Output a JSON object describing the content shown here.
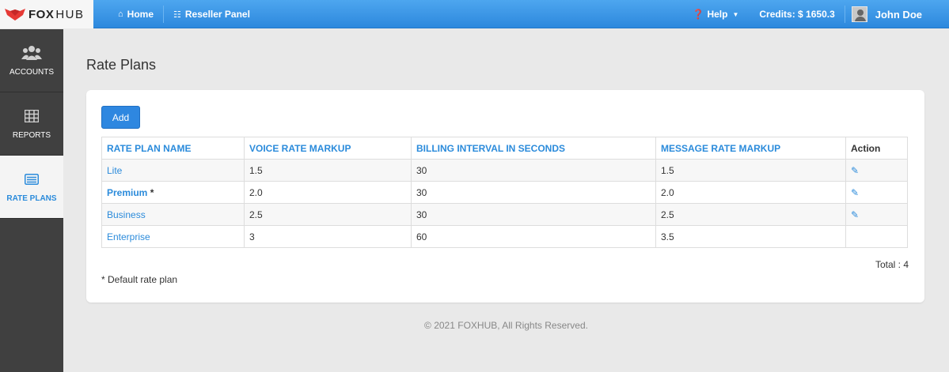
{
  "brand": {
    "part1": "FOX",
    "part2": "HUB"
  },
  "nav": {
    "home": "Home",
    "reseller": "Reseller Panel",
    "help": "Help",
    "credits": "Credits: $ 1650.3",
    "user": "John Doe"
  },
  "sidebar": {
    "items": [
      {
        "label": "ACCOUNTS",
        "icon": "users-icon"
      },
      {
        "label": "REPORTS",
        "icon": "table-icon"
      },
      {
        "label": "RATE PLANS",
        "icon": "rate-plans-icon",
        "active": true
      }
    ]
  },
  "page": {
    "title": "Rate Plans"
  },
  "toolbar": {
    "add_label": "Add"
  },
  "table": {
    "headers": [
      "RATE PLAN NAME",
      "VOICE RATE MARKUP",
      "BILLING INTERVAL IN SECONDS",
      "MESSAGE RATE MARKUP",
      "Action"
    ],
    "rows": [
      {
        "name": "Lite",
        "voice": "1.5",
        "interval": "30",
        "message": "1.5",
        "editable": true
      },
      {
        "name": "Premium",
        "default_marker": "*",
        "voice": "2.0",
        "interval": "30",
        "message": "2.0",
        "editable": true
      },
      {
        "name": "Business",
        "voice": "2.5",
        "interval": "30",
        "message": "2.5",
        "editable": true
      },
      {
        "name": "Enterprise",
        "voice": "3",
        "interval": "60",
        "message": "3.5",
        "editable": false
      }
    ]
  },
  "total": "Total : 4",
  "footnote": "* Default rate plan",
  "footer": "© 2021 FOXHUB, All Rights Reserved.",
  "colors": {
    "accent": "#2b8bdb",
    "topbar": "#3d97e6",
    "sidebar": "#404040"
  }
}
